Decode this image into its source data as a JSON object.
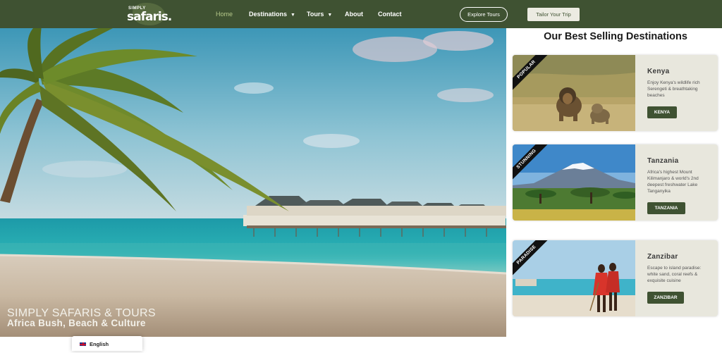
{
  "header": {
    "logo_small": "SIMPLY",
    "logo_big": "safaris.",
    "nav": [
      {
        "label": "Home"
      },
      {
        "label": "Destinations"
      },
      {
        "label": "Tours"
      },
      {
        "label": "About"
      },
      {
        "label": "Contact"
      }
    ],
    "explore_label": "Explore Tours",
    "tailor_label": "Tailor Your Trip"
  },
  "hero": {
    "title": "SIMPLY SAFARIS & TOURS",
    "subtitle": "Africa Bush, Beach & Culture"
  },
  "language": {
    "label": "English"
  },
  "destinations": {
    "title": "Our Best Selling Destinations",
    "cards": [
      {
        "ribbon": "POPULAR",
        "title": "Kenya",
        "description": "Enjoy Kenya's wildlife rich Serengeti & breathtaking beaches",
        "button": "KENYA"
      },
      {
        "ribbon": "STUNNING",
        "title": "Tanzania",
        "description": "Africa's highest Mount Kilimanjaro & world's 2nd deepest freshwater Lake Tanganyika",
        "button": "TANZANIA"
      },
      {
        "ribbon": "PARADISE",
        "title": "Zanzibar",
        "description": "Escape to island paradise: white sand, coral reefs & exquisite cuisine",
        "button": "ZANZIBAR"
      }
    ]
  },
  "colors": {
    "header_bg": "#3f5232",
    "nav_active": "#b6c98a",
    "card_bg": "#e8e7dd",
    "button_green": "#3f5232"
  },
  "icons": [
    "dropdown-caret-icon",
    "uk-flag-icon"
  ]
}
